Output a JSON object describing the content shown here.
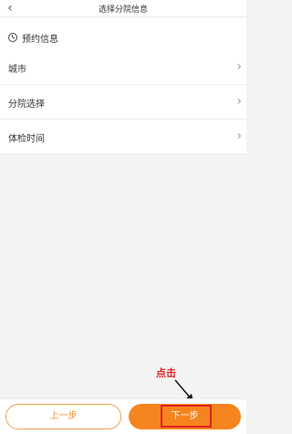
{
  "header": {
    "title": "选择分院信息",
    "back_icon": "chevron-left-icon"
  },
  "section": {
    "title": "预约信息",
    "icon": "clock-icon"
  },
  "rows": [
    {
      "label": "城市",
      "icon": "chevron-right-icon"
    },
    {
      "label": "分院选择",
      "icon": "chevron-right-icon"
    },
    {
      "label": "体检时间",
      "icon": "chevron-right-icon"
    }
  ],
  "footer": {
    "prev_label": "上一步",
    "next_label": "下一步"
  },
  "annotation": {
    "text": "点击",
    "color": "#e02020"
  },
  "colors": {
    "accent": "#f5841f",
    "background": "#f3f3f3"
  }
}
